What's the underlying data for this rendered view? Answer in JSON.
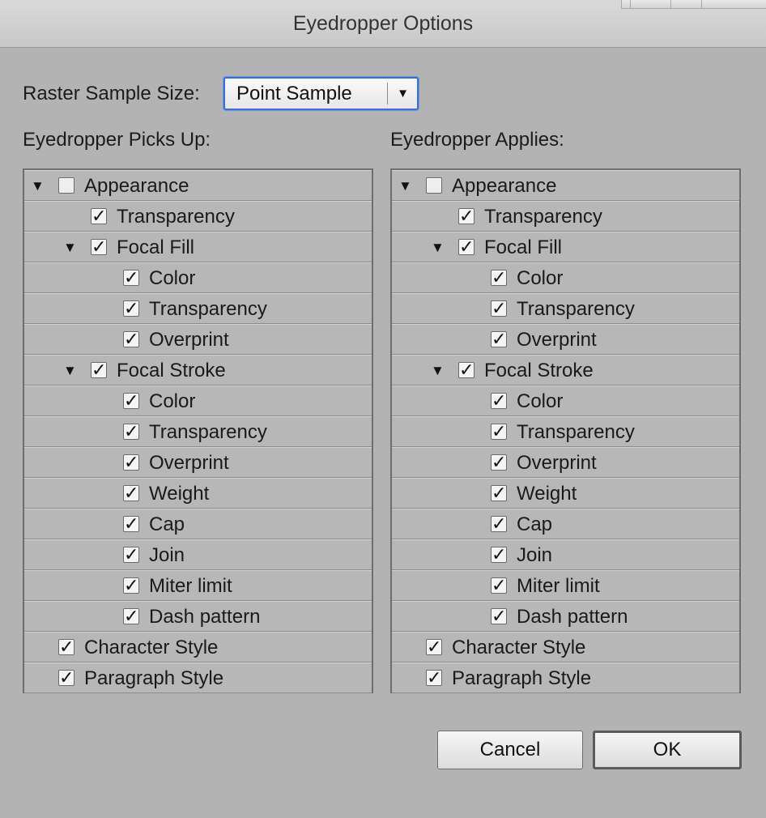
{
  "window": {
    "title": "Eyedropper Options"
  },
  "raster": {
    "label": "Raster Sample Size:",
    "value": "Point Sample",
    "arrow_icon": "triangle-down"
  },
  "panels": [
    {
      "heading": "Eyedropper Picks Up:",
      "items": [
        {
          "label": "Appearance",
          "checked": false,
          "level": 0,
          "expand": true
        },
        {
          "label": "Transparency",
          "checked": true,
          "level": 1,
          "expand": false
        },
        {
          "label": "Focal Fill",
          "checked": true,
          "level": 1,
          "expand": true
        },
        {
          "label": "Color",
          "checked": true,
          "level": 2,
          "expand": false
        },
        {
          "label": "Transparency",
          "checked": true,
          "level": 2,
          "expand": false
        },
        {
          "label": "Overprint",
          "checked": true,
          "level": 2,
          "expand": false
        },
        {
          "label": "Focal Stroke",
          "checked": true,
          "level": 1,
          "expand": true
        },
        {
          "label": "Color",
          "checked": true,
          "level": 2,
          "expand": false
        },
        {
          "label": "Transparency",
          "checked": true,
          "level": 2,
          "expand": false
        },
        {
          "label": "Overprint",
          "checked": true,
          "level": 2,
          "expand": false
        },
        {
          "label": "Weight",
          "checked": true,
          "level": 2,
          "expand": false
        },
        {
          "label": "Cap",
          "checked": true,
          "level": 2,
          "expand": false
        },
        {
          "label": "Join",
          "checked": true,
          "level": 2,
          "expand": false
        },
        {
          "label": "Miter limit",
          "checked": true,
          "level": 2,
          "expand": false
        },
        {
          "label": "Dash pattern",
          "checked": true,
          "level": 2,
          "expand": false
        },
        {
          "label": "Character Style",
          "checked": true,
          "level": 0,
          "expand": false
        },
        {
          "label": "Paragraph Style",
          "checked": true,
          "level": 0,
          "expand": false
        }
      ]
    },
    {
      "heading": "Eyedropper Applies:",
      "items": [
        {
          "label": "Appearance",
          "checked": false,
          "level": 0,
          "expand": true
        },
        {
          "label": "Transparency",
          "checked": true,
          "level": 1,
          "expand": false
        },
        {
          "label": "Focal Fill",
          "checked": true,
          "level": 1,
          "expand": true
        },
        {
          "label": "Color",
          "checked": true,
          "level": 2,
          "expand": false
        },
        {
          "label": "Transparency",
          "checked": true,
          "level": 2,
          "expand": false
        },
        {
          "label": "Overprint",
          "checked": true,
          "level": 2,
          "expand": false
        },
        {
          "label": "Focal Stroke",
          "checked": true,
          "level": 1,
          "expand": true
        },
        {
          "label": "Color",
          "checked": true,
          "level": 2,
          "expand": false
        },
        {
          "label": "Transparency",
          "checked": true,
          "level": 2,
          "expand": false
        },
        {
          "label": "Overprint",
          "checked": true,
          "level": 2,
          "expand": false
        },
        {
          "label": "Weight",
          "checked": true,
          "level": 2,
          "expand": false
        },
        {
          "label": "Cap",
          "checked": true,
          "level": 2,
          "expand": false
        },
        {
          "label": "Join",
          "checked": true,
          "level": 2,
          "expand": false
        },
        {
          "label": "Miter limit",
          "checked": true,
          "level": 2,
          "expand": false
        },
        {
          "label": "Dash pattern",
          "checked": true,
          "level": 2,
          "expand": false
        },
        {
          "label": "Character Style",
          "checked": true,
          "level": 0,
          "expand": false
        },
        {
          "label": "Paragraph Style",
          "checked": true,
          "level": 0,
          "expand": false
        }
      ]
    }
  ],
  "buttons": {
    "cancel": "Cancel",
    "ok": "OK"
  },
  "icons": {
    "expand": "disclosure-triangle-down",
    "check": "checkmark"
  }
}
